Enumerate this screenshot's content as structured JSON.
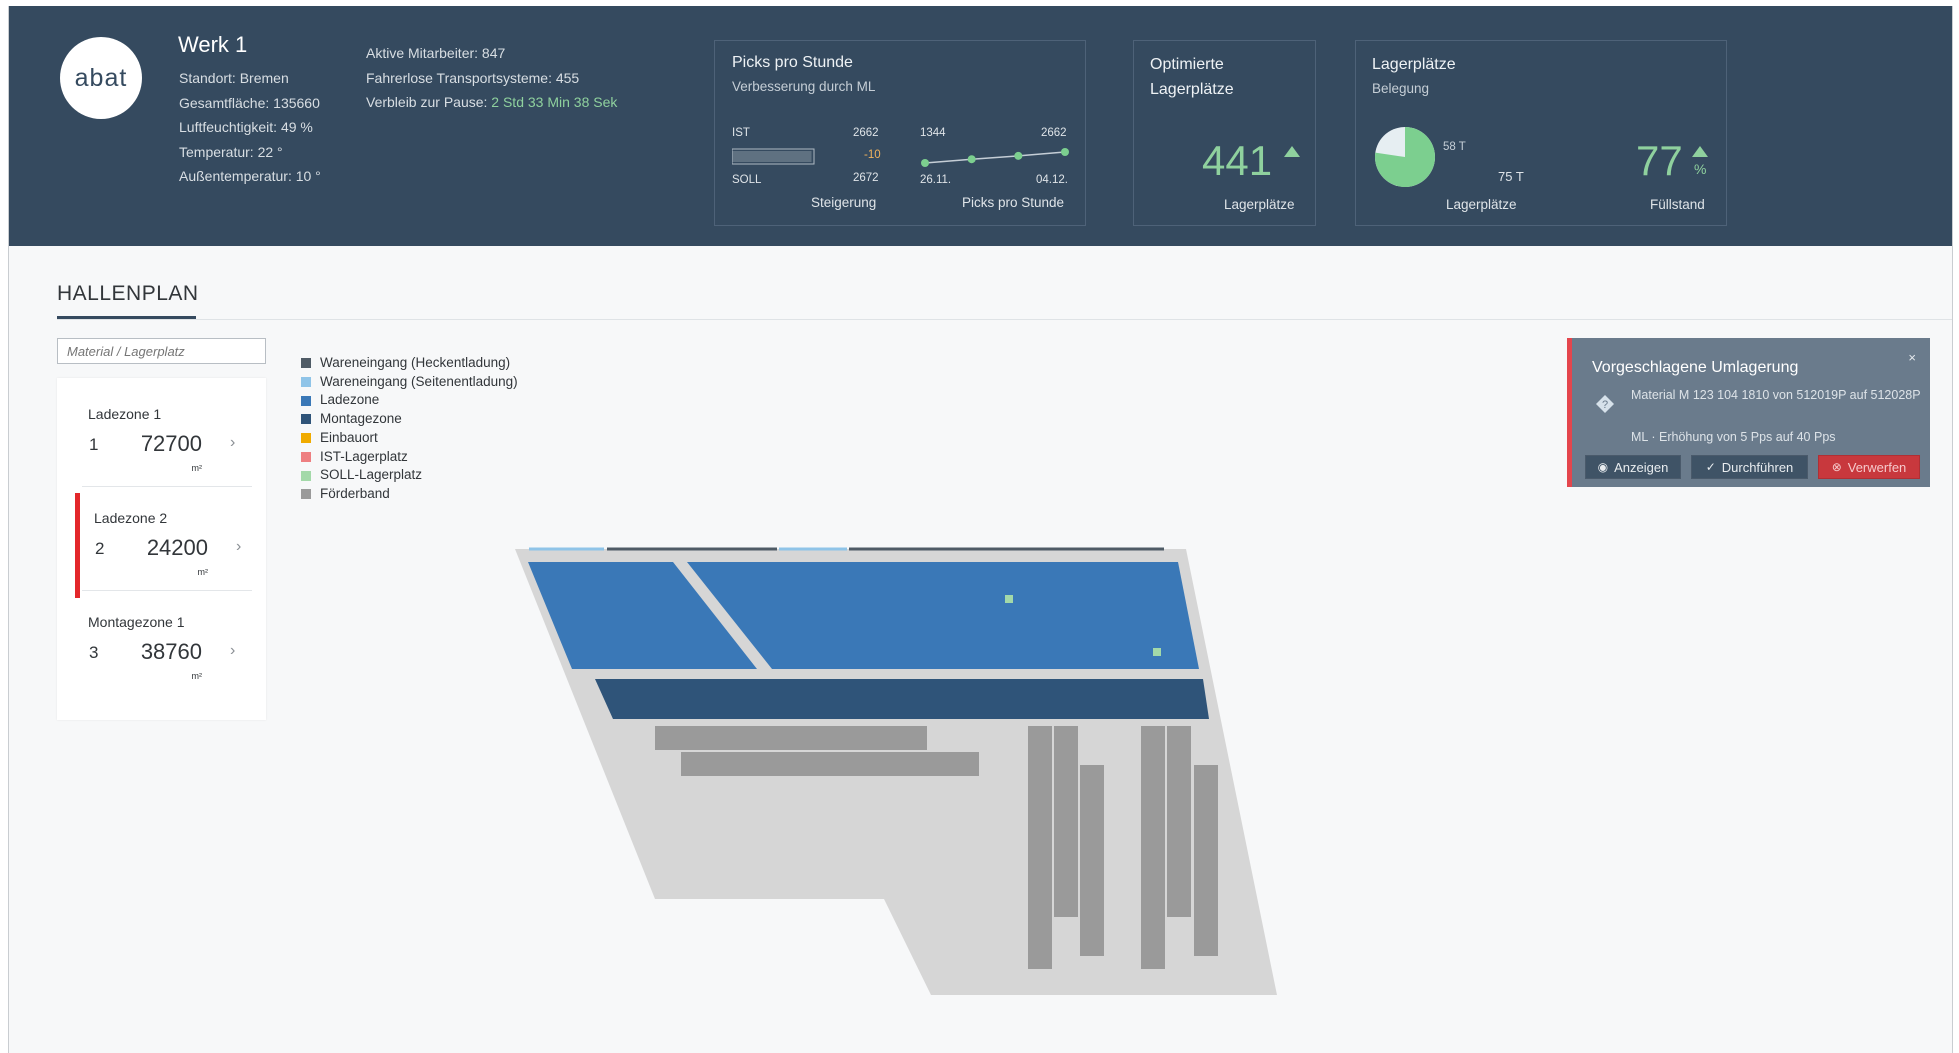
{
  "header": {
    "logo_text": "abat",
    "plant_title": "Werk 1",
    "details": [
      "Standort: Bremen",
      "Gesamtfläche: 135660",
      "Luftfeuchtigkeit: 49 %",
      "Temperatur: 22 °",
      "Außentemperatur: 10 °"
    ],
    "stats": {
      "employees": "Aktive Mitarbeiter: 847",
      "transport": "Fahrerlose Transportsysteme: 455",
      "break_label": "Verbleib zur Pause:",
      "break_value": "2 Std 33 Min 38 Sek"
    }
  },
  "picks_card": {
    "title": "Picks pro Stunde",
    "subtitle": "Verbesserung durch ML",
    "ist_label": "IST",
    "ist_value": "2662",
    "diff_value": "-10",
    "soll_label": "SOLL",
    "soll_value": "2672",
    "bar_fill_fraction": 0.97,
    "foot_left": "Steigerung",
    "line_start_value": "1344",
    "line_end_value": "2662",
    "line_start_date": "26.11.",
    "line_end_date": "04.12.",
    "line_points": [
      1344,
      1800,
      2200,
      2662
    ],
    "foot_right": "Picks pro Stunde"
  },
  "optimized_card": {
    "title_line1": "Optimierte",
    "title_line2": "Lagerplätze",
    "value": "441",
    "trend": "up",
    "foot": "Lagerplätze"
  },
  "storage_card": {
    "title": "Lagerplätze",
    "subtitle": "Belegung",
    "pie_value": "58 T",
    "pie_total": "75 T",
    "pie_fraction": 0.773,
    "foot_left": "Lagerplätze",
    "fill_value": "77",
    "fill_unit": "%",
    "trend": "up",
    "foot_right": "Füllstand"
  },
  "section": {
    "title": "HALLENPLAN",
    "search_placeholder": "Material / Lagerplatz"
  },
  "zones": [
    {
      "name": "Ladezone 1",
      "index": "1",
      "value": "72700",
      "unit": "m²",
      "selected": false
    },
    {
      "name": "Ladezone 2",
      "index": "2",
      "value": "24200",
      "unit": "m²",
      "selected": true
    },
    {
      "name": "Montagezone 1",
      "index": "3",
      "value": "38760",
      "unit": "m²",
      "selected": false
    }
  ],
  "legend": [
    {
      "label": "Wareneingang (Heckentladung)",
      "color": "#4f5b66"
    },
    {
      "label": "Wareneingang (Seitenentladung)",
      "color": "#8fc4e8"
    },
    {
      "label": "Ladezone",
      "color": "#3a78b7"
    },
    {
      "label": "Montagezone",
      "color": "#2f5479"
    },
    {
      "label": "Einbauort",
      "color": "#f0ab00"
    },
    {
      "label": "IST-Lagerplatz",
      "color": "#ee7f81"
    },
    {
      "label": "SOLL-Lagerplatz",
      "color": "#a3d9a9"
    },
    {
      "label": "Förderband",
      "color": "#9a9a9a"
    }
  ],
  "notification": {
    "title": "Vorgeschlagene Umlagerung",
    "close": "×",
    "message": "Material M 123 104 1810 von 512019P auf 512028P",
    "ml_line": "ML  ·  Erhöhung von 5 Pps auf 40 Pps",
    "btn_show": "Anzeigen",
    "btn_execute": "Durchführen",
    "btn_reject": "Verwerfen",
    "accent_color": "#e4464d"
  },
  "colors": {
    "header_bg": "#354a5f",
    "accent_green": "#8fd19e",
    "floor": "#d6d6d6",
    "ladezone": "#3a78b7",
    "montagezone": "#2f5479",
    "foerderband": "#9a9a9a",
    "soll_lagerplatz": "#a3d9a9"
  }
}
